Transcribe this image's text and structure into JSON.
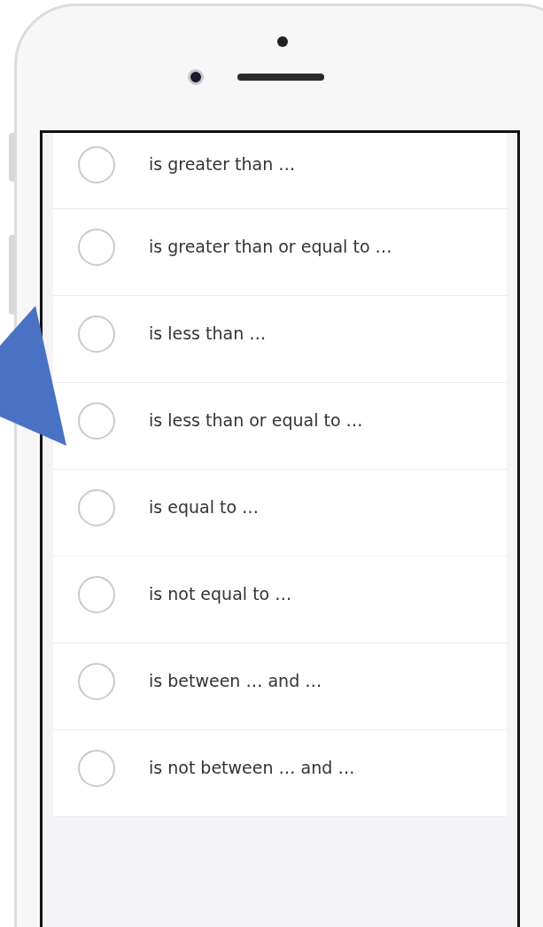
{
  "options": [
    {
      "label": "is greater than …",
      "selected": false
    },
    {
      "label": "is greater than or equal to …",
      "selected": false
    },
    {
      "label": "is less than …",
      "selected": false
    },
    {
      "label": "is less than or equal to …",
      "selected": false
    },
    {
      "label": "is equal to …",
      "selected": false
    },
    {
      "label": "is not equal to …",
      "selected": false
    },
    {
      "label": "is between … and …",
      "selected": false
    },
    {
      "label": "is not between … and …",
      "selected": false
    }
  ]
}
